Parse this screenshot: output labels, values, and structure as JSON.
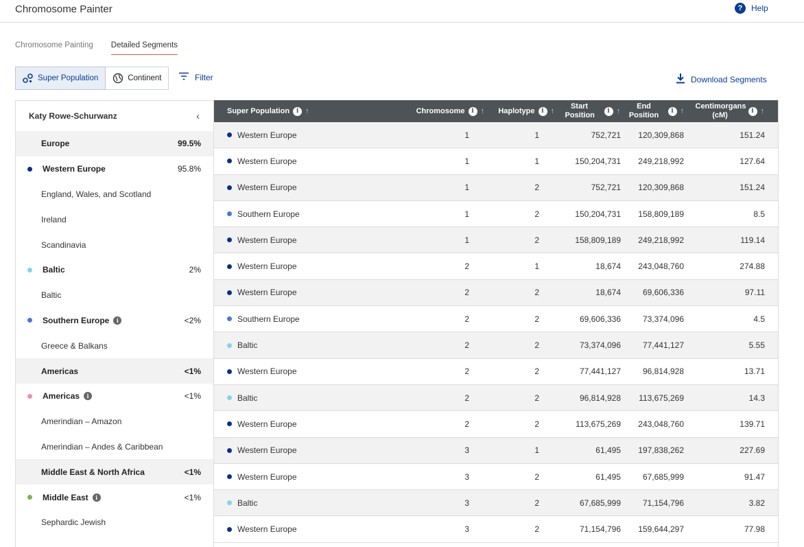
{
  "app": {
    "title": "Chromosome Painter",
    "help_label": "Help",
    "help_icon": "question-circle-icon"
  },
  "tabs": [
    {
      "label": "Chromosome Painting",
      "active": false
    },
    {
      "label": "Detailed Segments",
      "active": true
    }
  ],
  "view_toggle": {
    "super_population": "Super Population",
    "continent": "Continent",
    "selected": "Super Population"
  },
  "filter_label": "Filter",
  "download_label": "Download Segments",
  "colors": {
    "western_europe": "#0b2f8a",
    "southern_europe": "#4a78d6",
    "baltic": "#7fd6e6",
    "americas": "#ec8fb7",
    "middle_east": "#7ab648",
    "accent": "#0b3d91",
    "header_bg": "#4d5356"
  },
  "sidebar": {
    "user": "Katy Rowe-Schurwanz",
    "collapse_icon": "chevron-left-icon",
    "rows": [
      {
        "kind": "region",
        "label": "Europe",
        "pct": "99.5%"
      },
      {
        "kind": "pop",
        "label": "Western Europe",
        "pct": "95.8%",
        "color": "#0b2f8a"
      },
      {
        "kind": "sub",
        "label": "England, Wales, and Scotland"
      },
      {
        "kind": "sub",
        "label": "Ireland"
      },
      {
        "kind": "sub",
        "label": "Scandinavia"
      },
      {
        "kind": "pop",
        "label": "Baltic",
        "pct": "2%",
        "color": "#7fd6e6"
      },
      {
        "kind": "sub",
        "label": "Baltic"
      },
      {
        "kind": "pop",
        "label": "Southern Europe",
        "pct": "<2%",
        "color": "#4a78d6",
        "info": true
      },
      {
        "kind": "sub",
        "label": "Greece & Balkans"
      },
      {
        "kind": "region",
        "label": "Americas",
        "pct": "<1%"
      },
      {
        "kind": "pop",
        "label": "Americas",
        "pct": "<1%",
        "color": "#ec8fb7",
        "info": true
      },
      {
        "kind": "sub",
        "label": "Amerindian – Amazon"
      },
      {
        "kind": "sub",
        "label": "Amerindian – Andes & Caribbean"
      },
      {
        "kind": "region",
        "label": "Middle East & North Africa",
        "pct": "<1%"
      },
      {
        "kind": "pop",
        "label": "Middle East",
        "pct": "<1%",
        "color": "#7ab648",
        "info": true
      },
      {
        "kind": "sub",
        "label": "Sephardic Jewish"
      }
    ]
  },
  "table": {
    "columns": [
      {
        "label": "Super Population"
      },
      {
        "label": "Chromosome"
      },
      {
        "label": "Haplotype"
      },
      {
        "label": "Start Position"
      },
      {
        "label": "End Position"
      },
      {
        "label": "Centimorgans (cM)"
      }
    ],
    "rows": [
      {
        "pop": "Western Europe",
        "color": "#0b2f8a",
        "chromosome": "1",
        "haplotype": "1",
        "start": "752,721",
        "end": "120,309,868",
        "cm": "151.24"
      },
      {
        "pop": "Western Europe",
        "color": "#0b2f8a",
        "chromosome": "1",
        "haplotype": "1",
        "start": "150,204,731",
        "end": "249,218,992",
        "cm": "127.64"
      },
      {
        "pop": "Western Europe",
        "color": "#0b2f8a",
        "chromosome": "1",
        "haplotype": "2",
        "start": "752,721",
        "end": "120,309,868",
        "cm": "151.24"
      },
      {
        "pop": "Southern Europe",
        "color": "#4a78d6",
        "chromosome": "1",
        "haplotype": "2",
        "start": "150,204,731",
        "end": "158,809,189",
        "cm": "8.5"
      },
      {
        "pop": "Western Europe",
        "color": "#0b2f8a",
        "chromosome": "1",
        "haplotype": "2",
        "start": "158,809,189",
        "end": "249,218,992",
        "cm": "119.14"
      },
      {
        "pop": "Western Europe",
        "color": "#0b2f8a",
        "chromosome": "2",
        "haplotype": "1",
        "start": "18,674",
        "end": "243,048,760",
        "cm": "274.88"
      },
      {
        "pop": "Western Europe",
        "color": "#0b2f8a",
        "chromosome": "2",
        "haplotype": "2",
        "start": "18,674",
        "end": "69,606,336",
        "cm": "97.11"
      },
      {
        "pop": "Southern Europe",
        "color": "#4a78d6",
        "chromosome": "2",
        "haplotype": "2",
        "start": "69,606,336",
        "end": "73,374,096",
        "cm": "4.5"
      },
      {
        "pop": "Baltic",
        "color": "#7fd6e6",
        "chromosome": "2",
        "haplotype": "2",
        "start": "73,374,096",
        "end": "77,441,127",
        "cm": "5.55"
      },
      {
        "pop": "Western Europe",
        "color": "#0b2f8a",
        "chromosome": "2",
        "haplotype": "2",
        "start": "77,441,127",
        "end": "96,814,928",
        "cm": "13.71"
      },
      {
        "pop": "Baltic",
        "color": "#7fd6e6",
        "chromosome": "2",
        "haplotype": "2",
        "start": "96,814,928",
        "end": "113,675,269",
        "cm": "14.3"
      },
      {
        "pop": "Western Europe",
        "color": "#0b2f8a",
        "chromosome": "2",
        "haplotype": "2",
        "start": "113,675,269",
        "end": "243,048,760",
        "cm": "139.71"
      },
      {
        "pop": "Western Europe",
        "color": "#0b2f8a",
        "chromosome": "3",
        "haplotype": "1",
        "start": "61,495",
        "end": "197,838,262",
        "cm": "227.69"
      },
      {
        "pop": "Western Europe",
        "color": "#0b2f8a",
        "chromosome": "3",
        "haplotype": "2",
        "start": "61,495",
        "end": "67,685,999",
        "cm": "91.47"
      },
      {
        "pop": "Baltic",
        "color": "#7fd6e6",
        "chromosome": "3",
        "haplotype": "2",
        "start": "67,685,999",
        "end": "71,154,796",
        "cm": "3.82"
      },
      {
        "pop": "Western Europe",
        "color": "#0b2f8a",
        "chromosome": "3",
        "haplotype": "2",
        "start": "71,154,796",
        "end": "159,644,297",
        "cm": "77.98"
      }
    ]
  }
}
